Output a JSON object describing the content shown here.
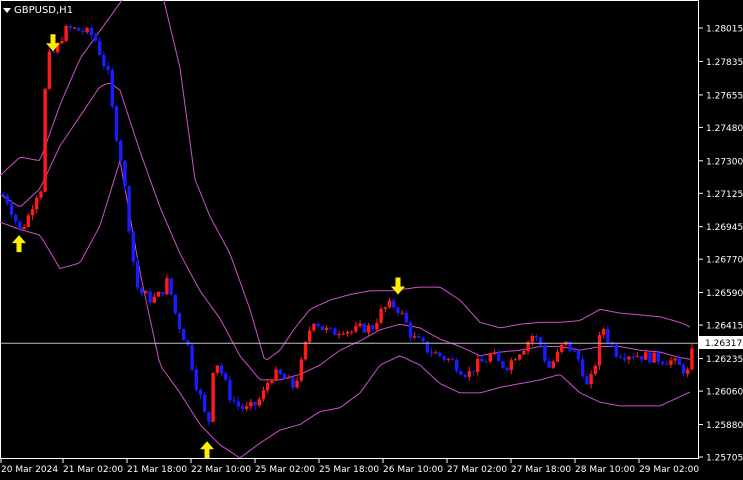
{
  "window": {
    "title": "GBPUSD,H1"
  },
  "colors": {
    "background": "#000000",
    "frame": "#ffffff",
    "bull": "#ff1b1b",
    "bear": "#1b1bff",
    "bands": "#d04fd0",
    "arrows": "#ffee00",
    "price_line": "#c0c0c0",
    "text": "#ffffff"
  },
  "price_axis": {
    "labels": [
      "1.28015",
      "1.27835",
      "1.27655",
      "1.27480",
      "1.27300",
      "1.27125",
      "1.26945",
      "1.26770",
      "1.26590",
      "1.26415",
      "1.26235",
      "1.26060",
      "1.25880",
      "1.25705"
    ],
    "current_price": "1.26317"
  },
  "time_axis": {
    "labels": [
      "20 Mar 2024",
      "21 Mar 02:00",
      "21 Mar 18:00",
      "22 Mar 10:00",
      "25 Mar 02:00",
      "25 Mar 18:00",
      "26 Mar 10:00",
      "27 Mar 02:00",
      "27 Mar 18:00",
      "28 Mar 10:00",
      "29 Mar 02:00"
    ]
  },
  "chart_data": {
    "type": "candlestick",
    "symbol": "GBPUSD",
    "timeframe": "H1",
    "ylim": [
      1.2567,
      1.2825
    ],
    "close_path": [
      [
        0,
        1.2712
      ],
      [
        6,
        1.2708
      ],
      [
        12,
        1.27
      ],
      [
        18,
        1.2692
      ],
      [
        26,
        1.27
      ],
      [
        34,
        1.2712
      ],
      [
        40,
        1.2716
      ],
      [
        44,
        1.2785
      ],
      [
        50,
        1.2787
      ],
      [
        56,
        1.2792
      ],
      [
        62,
        1.28
      ],
      [
        70,
        1.2801
      ],
      [
        80,
        1.28
      ],
      [
        92,
        1.2797
      ],
      [
        100,
        1.2785
      ],
      [
        106,
        1.2776
      ],
      [
        112,
        1.275
      ],
      [
        118,
        1.2734
      ],
      [
        124,
        1.271
      ],
      [
        130,
        1.268
      ],
      [
        136,
        1.266
      ],
      [
        142,
        1.2658
      ],
      [
        150,
        1.2655
      ],
      [
        158,
        1.2658
      ],
      [
        166,
        1.2666
      ],
      [
        172,
        1.265
      ],
      [
        178,
        1.264
      ],
      [
        186,
        1.263
      ],
      [
        194,
        1.261
      ],
      [
        200,
        1.26
      ],
      [
        206,
        1.2585
      ],
      [
        212,
        1.2625
      ],
      [
        220,
        1.2615
      ],
      [
        228,
        1.2603
      ],
      [
        236,
        1.2598
      ],
      [
        244,
        1.2596
      ],
      [
        252,
        1.2598
      ],
      [
        260,
        1.2603
      ],
      [
        268,
        1.2614
      ],
      [
        276,
        1.2615
      ],
      [
        284,
        1.2612
      ],
      [
        292,
        1.2608
      ],
      [
        300,
        1.2622
      ],
      [
        306,
        1.2637
      ],
      [
        312,
        1.2645
      ],
      [
        320,
        1.264
      ],
      [
        330,
        1.2637
      ],
      [
        340,
        1.264
      ],
      [
        350,
        1.2638
      ],
      [
        360,
        1.264
      ],
      [
        370,
        1.264
      ],
      [
        378,
        1.2648
      ],
      [
        386,
        1.2652
      ],
      [
        394,
        1.2652
      ],
      [
        402,
        1.2645
      ],
      [
        410,
        1.2635
      ],
      [
        418,
        1.2632
      ],
      [
        426,
        1.2628
      ],
      [
        434,
        1.2626
      ],
      [
        442,
        1.2624
      ],
      [
        450,
        1.2622
      ],
      [
        458,
        1.2618
      ],
      [
        466,
        1.2615
      ],
      [
        474,
        1.262
      ],
      [
        482,
        1.2622
      ],
      [
        490,
        1.2626
      ],
      [
        498,
        1.262
      ],
      [
        506,
        1.262
      ],
      [
        514,
        1.2626
      ],
      [
        522,
        1.263
      ],
      [
        530,
        1.2636
      ],
      [
        538,
        1.2632
      ],
      [
        546,
        1.2618
      ],
      [
        554,
        1.2624
      ],
      [
        562,
        1.2632
      ],
      [
        570,
        1.2628
      ],
      [
        578,
        1.2622
      ],
      [
        586,
        1.2606
      ],
      [
        594,
        1.2623
      ],
      [
        600,
        1.2642
      ],
      [
        606,
        1.2634
      ],
      [
        614,
        1.2627
      ],
      [
        622,
        1.2626
      ],
      [
        630,
        1.2626
      ],
      [
        640,
        1.2625
      ],
      [
        650,
        1.2624
      ],
      [
        660,
        1.2623
      ],
      [
        670,
        1.2622
      ],
      [
        680,
        1.2618
      ],
      [
        686,
        1.2616
      ],
      [
        692,
        1.2632
      ]
    ],
    "bollinger_upper": [
      [
        0,
        1.2722
      ],
      [
        20,
        1.2732
      ],
      [
        40,
        1.273
      ],
      [
        60,
        1.276
      ],
      [
        80,
        1.2785
      ],
      [
        100,
        1.28
      ],
      [
        120,
        1.2815
      ],
      [
        140,
        1.283
      ],
      [
        160,
        1.2825
      ],
      [
        180,
        1.278
      ],
      [
        195,
        1.272
      ],
      [
        210,
        1.27
      ],
      [
        230,
        1.268
      ],
      [
        250,
        1.265
      ],
      [
        265,
        1.2622
      ],
      [
        280,
        1.2628
      ],
      [
        295,
        1.264
      ],
      [
        310,
        1.265
      ],
      [
        330,
        1.2655
      ],
      [
        350,
        1.2658
      ],
      [
        370,
        1.266
      ],
      [
        390,
        1.266
      ],
      [
        420,
        1.2662
      ],
      [
        440,
        1.2662
      ],
      [
        460,
        1.2655
      ],
      [
        480,
        1.2643
      ],
      [
        500,
        1.264
      ],
      [
        520,
        1.2642
      ],
      [
        540,
        1.2643
      ],
      [
        560,
        1.2643
      ],
      [
        580,
        1.2644
      ],
      [
        600,
        1.265
      ],
      [
        620,
        1.2648
      ],
      [
        640,
        1.2647
      ],
      [
        660,
        1.2646
      ],
      [
        680,
        1.2643
      ],
      [
        692,
        1.264
      ]
    ],
    "bollinger_middle": [
      [
        0,
        1.2712
      ],
      [
        20,
        1.2705
      ],
      [
        40,
        1.2715
      ],
      [
        60,
        1.2738
      ],
      [
        80,
        1.2754
      ],
      [
        100,
        1.277
      ],
      [
        110,
        1.2772
      ],
      [
        120,
        1.2768
      ],
      [
        140,
        1.2735
      ],
      [
        160,
        1.2705
      ],
      [
        180,
        1.268
      ],
      [
        200,
        1.266
      ],
      [
        220,
        1.2645
      ],
      [
        240,
        1.2625
      ],
      [
        260,
        1.2612
      ],
      [
        280,
        1.2612
      ],
      [
        300,
        1.2615
      ],
      [
        320,
        1.262
      ],
      [
        340,
        1.2628
      ],
      [
        360,
        1.2633
      ],
      [
        380,
        1.2639
      ],
      [
        400,
        1.2642
      ],
      [
        420,
        1.264
      ],
      [
        440,
        1.2634
      ],
      [
        460,
        1.263
      ],
      [
        480,
        1.2625
      ],
      [
        500,
        1.2627
      ],
      [
        520,
        1.2628
      ],
      [
        540,
        1.263
      ],
      [
        560,
        1.263
      ],
      [
        580,
        1.2628
      ],
      [
        600,
        1.263
      ],
      [
        620,
        1.263
      ],
      [
        640,
        1.2628
      ],
      [
        660,
        1.2627
      ],
      [
        680,
        1.2624
      ],
      [
        692,
        1.2623
      ]
    ],
    "bollinger_lower": [
      [
        0,
        1.2697
      ],
      [
        20,
        1.2693
      ],
      [
        40,
        1.269
      ],
      [
        60,
        1.2672
      ],
      [
        80,
        1.2675
      ],
      [
        100,
        1.2695
      ],
      [
        120,
        1.273
      ],
      [
        140,
        1.267
      ],
      [
        160,
        1.262
      ],
      [
        180,
        1.2605
      ],
      [
        200,
        1.2588
      ],
      [
        220,
        1.2577
      ],
      [
        240,
        1.257
      ],
      [
        260,
        1.2578
      ],
      [
        280,
        1.2585
      ],
      [
        300,
        1.2588
      ],
      [
        320,
        1.2595
      ],
      [
        340,
        1.2597
      ],
      [
        360,
        1.2605
      ],
      [
        380,
        1.262
      ],
      [
        400,
        1.2625
      ],
      [
        420,
        1.262
      ],
      [
        440,
        1.261
      ],
      [
        460,
        1.2605
      ],
      [
        480,
        1.2605
      ],
      [
        500,
        1.2608
      ],
      [
        520,
        1.261
      ],
      [
        540,
        1.2612
      ],
      [
        560,
        1.2615
      ],
      [
        580,
        1.2605
      ],
      [
        600,
        1.26
      ],
      [
        620,
        1.2598
      ],
      [
        640,
        1.2598
      ],
      [
        660,
        1.2598
      ],
      [
        680,
        1.2603
      ],
      [
        692,
        1.2606
      ]
    ],
    "signal_arrows": [
      {
        "x": 19,
        "price": 1.269,
        "dir": "up"
      },
      {
        "x": 53,
        "price": 1.2789,
        "dir": "down"
      },
      {
        "x": 207,
        "price": 1.2579,
        "dir": "up"
      },
      {
        "x": 398,
        "price": 1.2658,
        "dir": "down"
      }
    ]
  }
}
